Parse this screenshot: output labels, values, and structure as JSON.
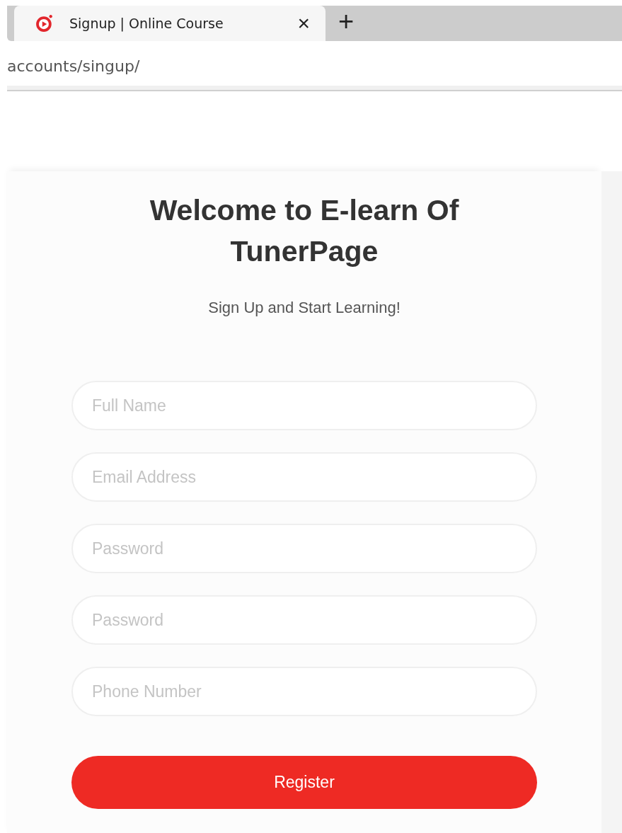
{
  "browser": {
    "tab": {
      "title": "Signup | Online Course",
      "close": "×",
      "selected": true
    },
    "new_tab": "+",
    "address": "accounts/singup/"
  },
  "page": {
    "title": "Welcome to E-learn Of TunerPage",
    "subtitle": "Sign Up and Start Learning!",
    "fields": [
      {
        "placeholder": "Full Name"
      },
      {
        "placeholder": "Email Address"
      },
      {
        "placeholder": "Password"
      },
      {
        "placeholder": "Password"
      },
      {
        "placeholder": "Phone Number"
      }
    ],
    "button": "Register"
  }
}
